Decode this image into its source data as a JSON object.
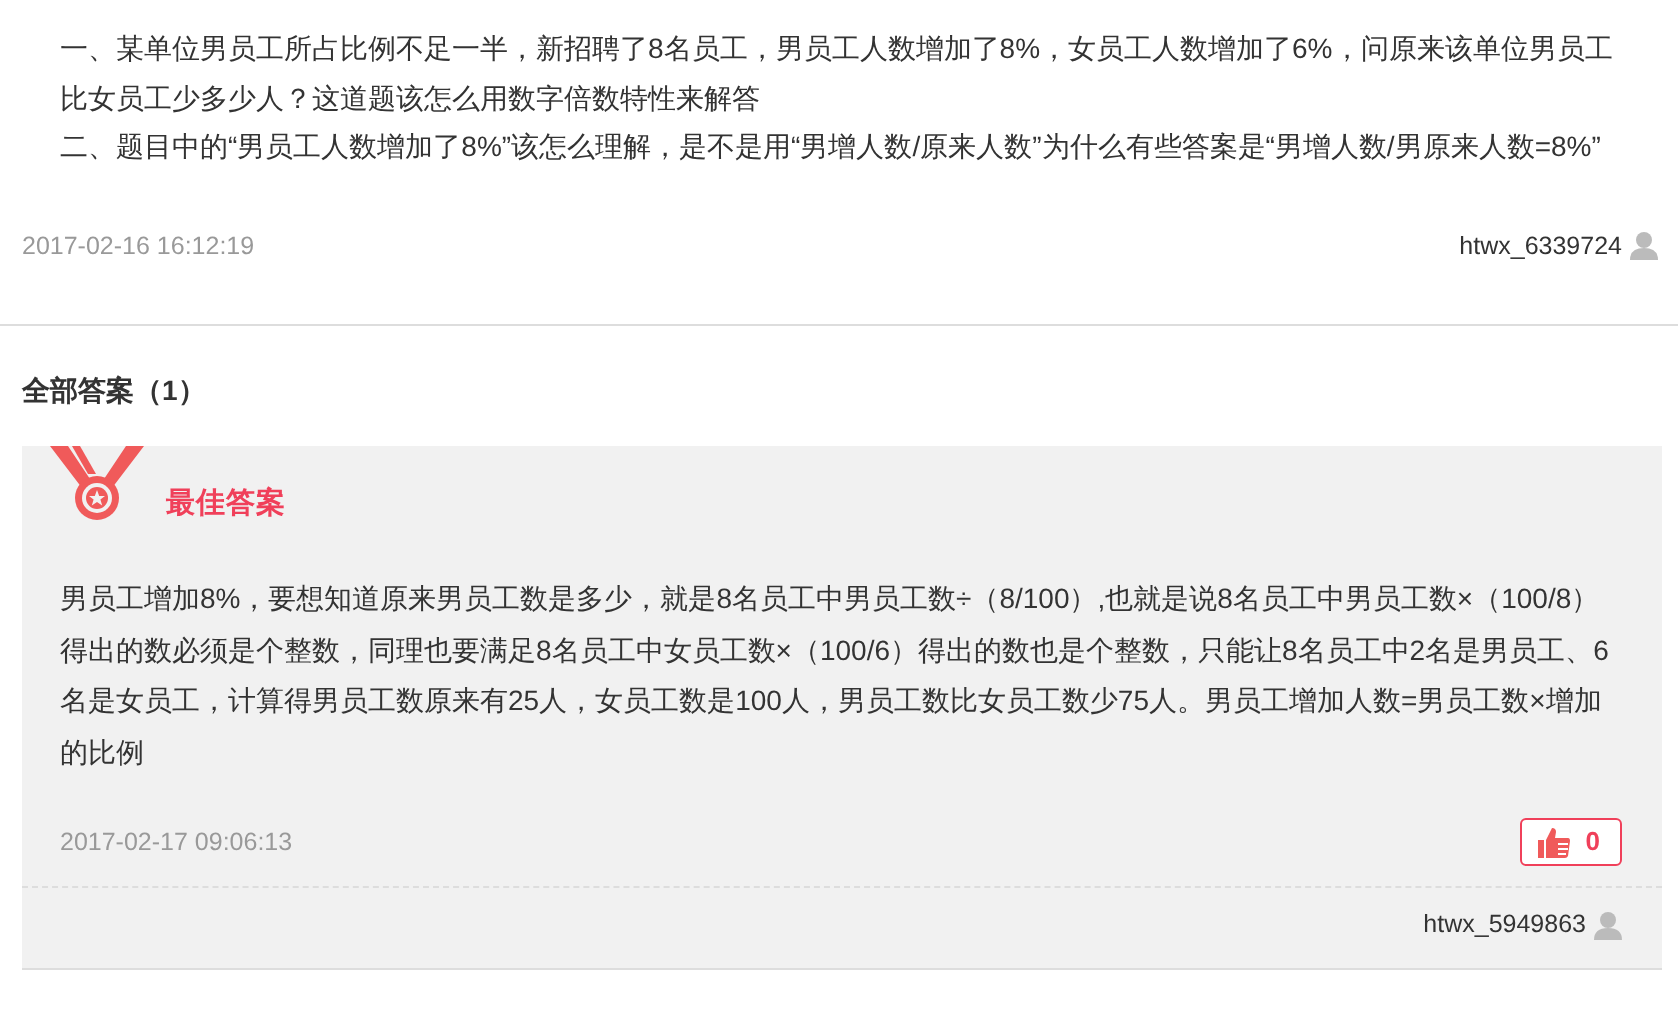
{
  "question": {
    "lines": [
      "一、某单位男员工所占比例不足一半，新招聘了8名员工，男员工人数增加了8%，女员工人数增加了6%，问原来该单位男员工比女员工少多少人？这道题该怎么用数字倍数特性来解答",
      "二、题目中的“男员工人数增加了8%”该怎么理解，是不是用“男增人数/原来人数”为什么有些答案是“男增人数/男原来人数=8%”"
    ],
    "date": "2017-02-16 16:12:19",
    "user": "htwx_6339724"
  },
  "answers_heading": "全部答案（1）",
  "answer": {
    "badge": "最佳答案",
    "text": "男员工增加8%，要想知道原来男员工数是多少，就是8名员工中男员工数÷（8/100）,也就是说8名员工中男员工数×（100/8）得出的数必须是个整数，同理也要满足8名员工中女员工数×（100/6）得出的数也是个整数，只能让8名员工中2名是男员工、6名是女员工，计算得男员工数原来有25人，女员工数是100人，男员工数比女员工数少75人。男员工增加人数=男员工数×增加的比例",
    "date": "2017-02-17 09:06:13",
    "likes": "0",
    "user": "htwx_5949863"
  }
}
